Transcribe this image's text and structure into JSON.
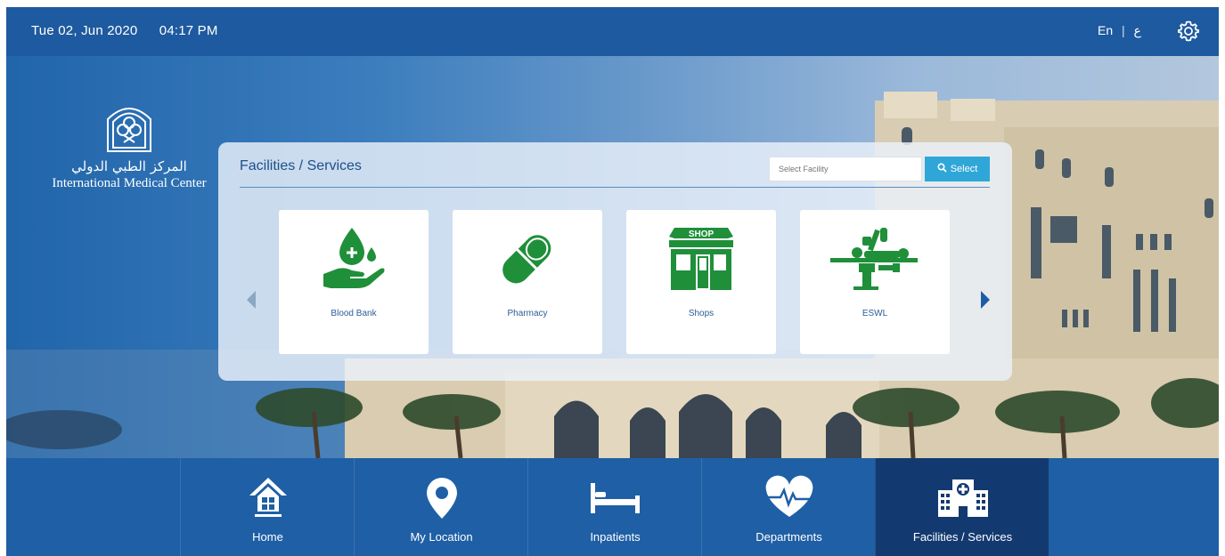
{
  "header": {
    "date": "Tue 02, Jun 2020",
    "time": "04:17 PM",
    "lang_en": "En",
    "lang_sep": "|",
    "lang_ar": "ع"
  },
  "logo": {
    "arabic": "المركز الطبي الدولي",
    "english": "International Medical Center"
  },
  "panel": {
    "title": "Facilities / Services",
    "search_placeholder": "Select Facility",
    "select_label": "Select",
    "cards": [
      {
        "label": "Blood Bank",
        "icon": "blood-donation-icon"
      },
      {
        "label": "Pharmacy",
        "icon": "capsule-icon"
      },
      {
        "label": "Shops",
        "icon": "shop-icon",
        "badge": "SHOP"
      },
      {
        "label": "ESWL",
        "icon": "lithotripsy-machine-icon"
      }
    ]
  },
  "nav": {
    "items": [
      {
        "label": "Home",
        "icon": "home-icon"
      },
      {
        "label": "My Location",
        "icon": "location-pin-icon"
      },
      {
        "label": "Inpatients",
        "icon": "bed-icon"
      },
      {
        "label": "Departments",
        "icon": "heart-pulse-icon"
      },
      {
        "label": "Facilities / Services",
        "icon": "hospital-icon",
        "active": true
      }
    ]
  },
  "colors": {
    "topbar": "#1e5a9f",
    "accent_green": "#1f8f3a",
    "select_button": "#2fa6d8",
    "nav_active": "#133a70"
  }
}
